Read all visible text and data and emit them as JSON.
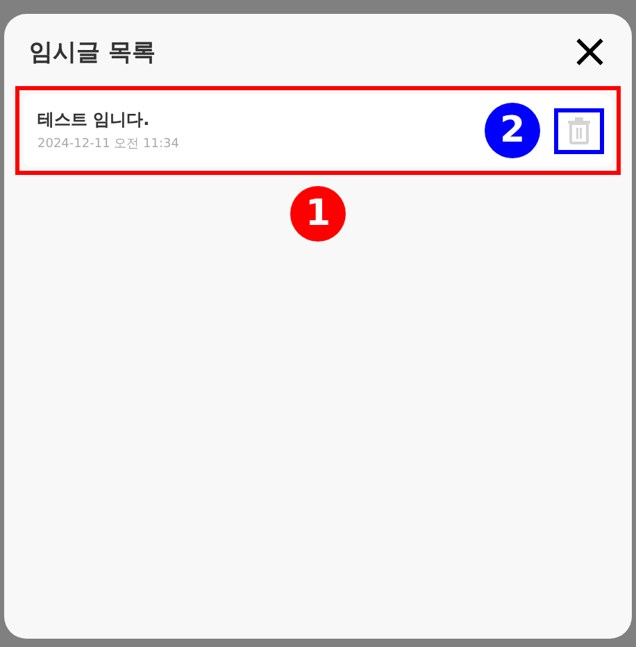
{
  "dialog": {
    "title": "임시글 목록",
    "close": "×"
  },
  "drafts": [
    {
      "title": "테스트 임니다.",
      "date": "2024-12-11 오전 11:34"
    }
  ],
  "annotations": [
    {
      "kind": "box",
      "color": "#ff0000"
    },
    {
      "kind": "badge",
      "label": "1",
      "color": "#ff0000"
    },
    {
      "kind": "badge",
      "label": "2",
      "color": "#0000ff"
    },
    {
      "kind": "box",
      "color": "#0000ff"
    }
  ]
}
